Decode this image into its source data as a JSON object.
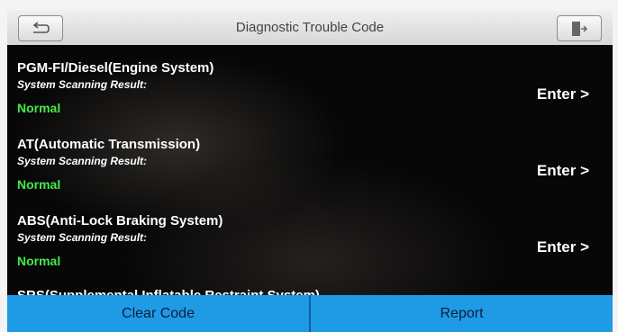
{
  "header": {
    "title": "Diagnostic Trouble Code"
  },
  "systems": [
    {
      "name": "PGM-FI/Diesel(Engine System)",
      "label": "System Scanning Result:",
      "status": "Normal",
      "action": "Enter >"
    },
    {
      "name": "AT(Automatic Transmission)",
      "label": "System Scanning Result:",
      "status": "Normal",
      "action": "Enter >"
    },
    {
      "name": "ABS(Anti-Lock Braking System)",
      "label": "System Scanning Result:",
      "status": "Normal",
      "action": "Enter >"
    },
    {
      "name": "SRS(Supplemental Inflatable Restraint System)"
    }
  ],
  "footer": {
    "clear_label": "Clear Code",
    "report_label": "Report"
  },
  "colors": {
    "header_bg": "#e4e4e4",
    "list_bg": "#070707",
    "status_normal": "#46e84a",
    "footer_button": "#1f9be6"
  },
  "icons": {
    "back": "back-arrow-icon",
    "exit": "exit-door-icon"
  }
}
